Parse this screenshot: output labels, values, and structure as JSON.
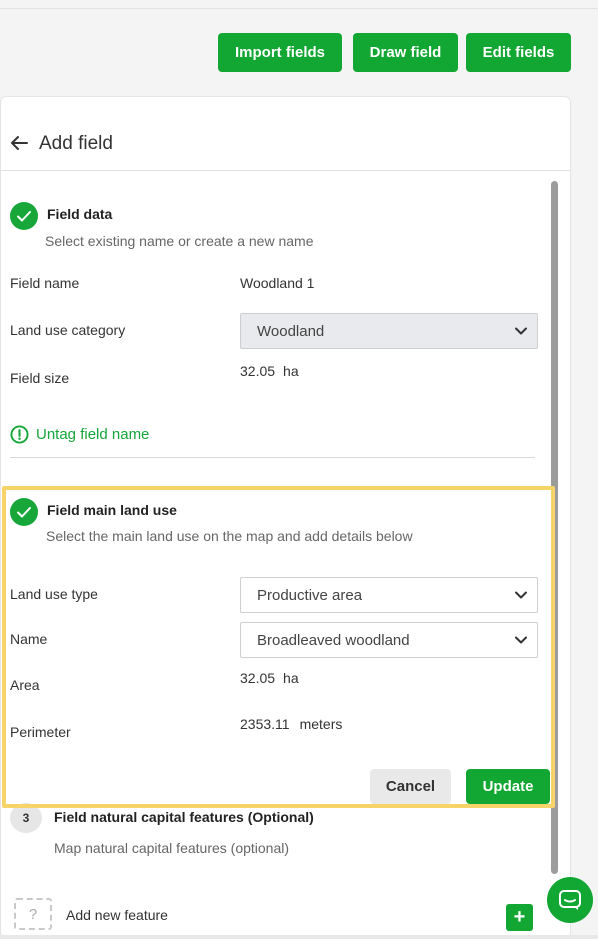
{
  "toolbar": {
    "import_label": "Import fields",
    "draw_label": "Draw field",
    "edit_label": "Edit fields"
  },
  "header": {
    "title": "Add field",
    "back_icon": "arrow-left-icon"
  },
  "field_data": {
    "title": "Field data",
    "subtitle": "Select existing name or create a new name",
    "field_name_label": "Field name",
    "field_name_value": "Woodland 1",
    "land_use_category_label": "Land use category",
    "land_use_category_value": "Woodland",
    "field_size_label": "Field size",
    "field_size_value": "32.05",
    "field_size_unit": "ha",
    "untag_label": "Untag field name"
  },
  "main_land_use": {
    "title": "Field main land use",
    "subtitle": "Select the main land use on the map and add details below",
    "land_use_type_label": "Land use type",
    "land_use_type_value": "Productive area",
    "name_label": "Name",
    "name_value": "Broadleaved woodland",
    "area_label": "Area",
    "area_value": "32.05",
    "area_unit": "ha",
    "perimeter_label": "Perimeter",
    "perimeter_value": "2353.11",
    "perimeter_unit": "meters",
    "cancel_label": "Cancel",
    "update_label": "Update"
  },
  "natural_capital": {
    "step_number": "3",
    "title": "Field natural capital features (Optional)",
    "subtitle": "Map natural capital features (optional)",
    "placeholder_glyph": "?",
    "add_feature_label": "Add new feature",
    "add_glyph": "+"
  },
  "colors": {
    "accent": "#12a632",
    "highlight": "#f7d46a"
  }
}
